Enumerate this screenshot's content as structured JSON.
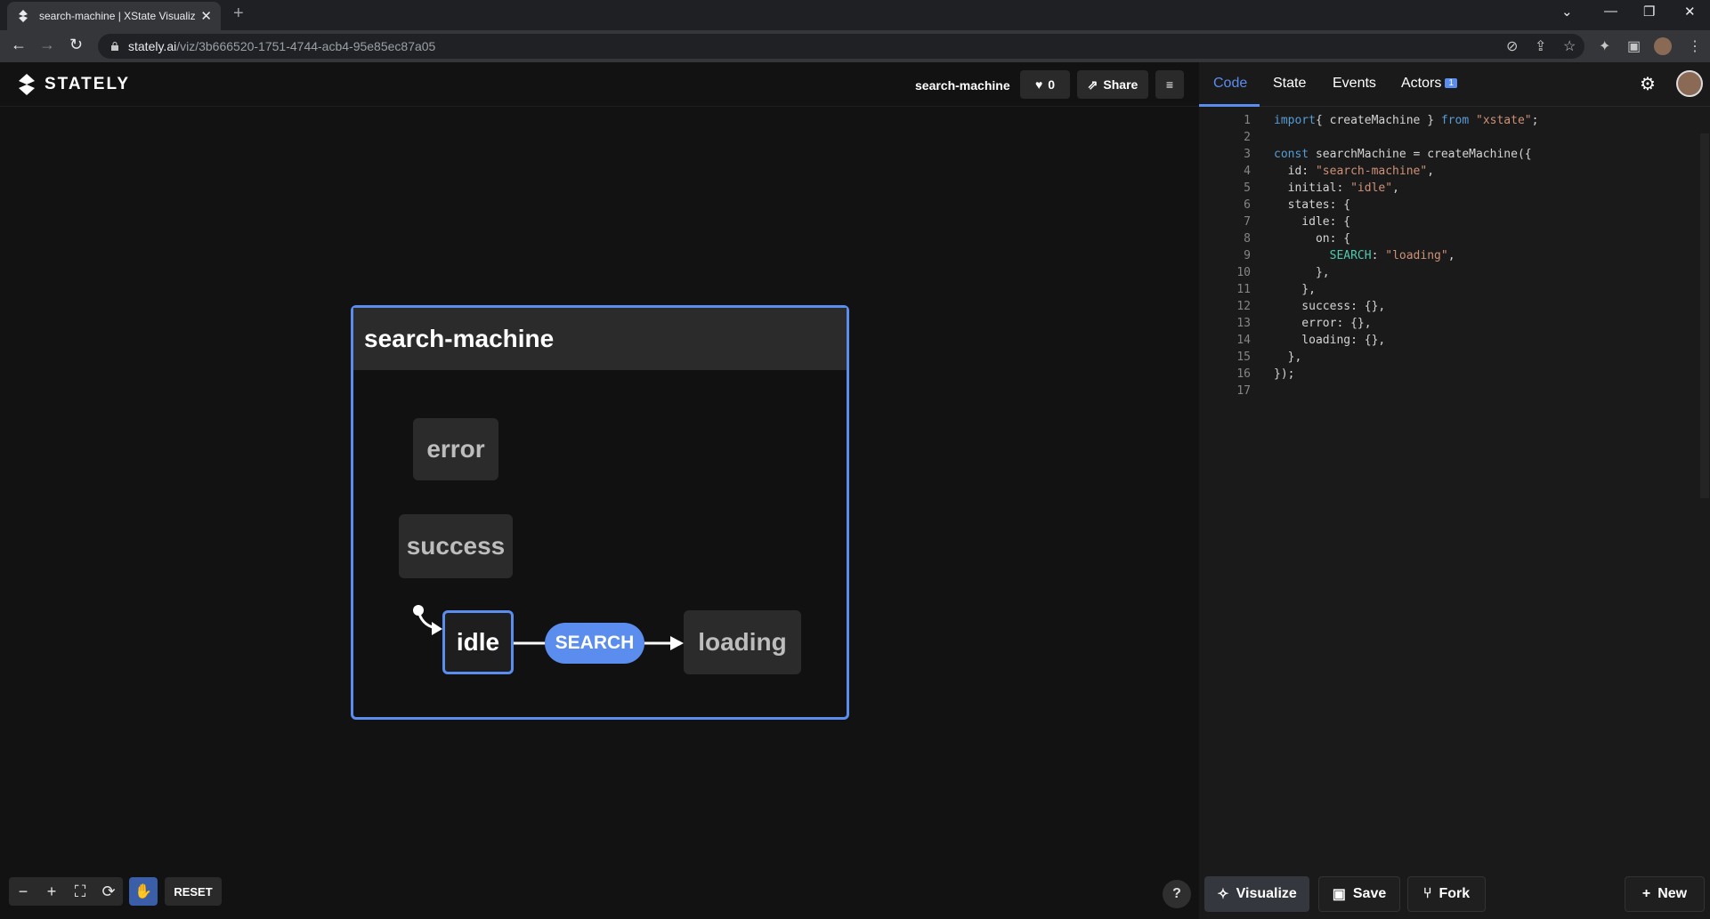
{
  "browser": {
    "tab_title": "search-machine | XState Visualizer",
    "url_host": "stately.ai",
    "url_path": "/viz/3b666520-1751-4744-acb4-95e85ec87a05"
  },
  "header": {
    "logo_text": "STATELY",
    "machine_name": "search-machine",
    "likes": "0",
    "share_label": "Share"
  },
  "panel": {
    "tabs": [
      {
        "label": "Code"
      },
      {
        "label": "State"
      },
      {
        "label": "Events"
      },
      {
        "label": "Actors",
        "badge": "1"
      }
    ],
    "active_tab": "Code"
  },
  "diagram": {
    "machine_title": "search-machine",
    "states": {
      "error": "error",
      "success": "success",
      "idle": "idle",
      "loading": "loading"
    },
    "event_label": "SEARCH",
    "active_state": "idle"
  },
  "code_lines": [
    {
      "n": "1",
      "parts": [
        [
          "kw",
          "import"
        ],
        [
          "",
          "{ createMachine } "
        ],
        [
          "kw",
          "from"
        ],
        [
          "",
          " "
        ],
        [
          "str",
          "\"xstate\""
        ],
        [
          "",
          ";"
        ]
      ]
    },
    {
      "n": "2",
      "parts": []
    },
    {
      "n": "3",
      "parts": [
        [
          "kw",
          "const"
        ],
        [
          "",
          " searchMachine = createMachine({"
        ]
      ]
    },
    {
      "n": "4",
      "parts": [
        [
          "",
          "  id: "
        ],
        [
          "str",
          "\"search-machine\""
        ],
        [
          "",
          ","
        ]
      ]
    },
    {
      "n": "5",
      "parts": [
        [
          "",
          "  initial: "
        ],
        [
          "str",
          "\"idle\""
        ],
        [
          "",
          ","
        ]
      ]
    },
    {
      "n": "6",
      "parts": [
        [
          "",
          "  states: {"
        ]
      ]
    },
    {
      "n": "7",
      "parts": [
        [
          "",
          "    idle: {"
        ]
      ]
    },
    {
      "n": "8",
      "parts": [
        [
          "",
          "      on: {"
        ]
      ]
    },
    {
      "n": "9",
      "parts": [
        [
          "",
          "        "
        ],
        [
          "evk",
          "SEARCH"
        ],
        [
          "",
          ": "
        ],
        [
          "str",
          "\"loading\""
        ],
        [
          "",
          ","
        ]
      ]
    },
    {
      "n": "10",
      "parts": [
        [
          "",
          "      },"
        ]
      ]
    },
    {
      "n": "11",
      "parts": [
        [
          "",
          "    },"
        ]
      ]
    },
    {
      "n": "12",
      "parts": [
        [
          "",
          "    success: {},"
        ]
      ]
    },
    {
      "n": "13",
      "parts": [
        [
          "",
          "    error: {},"
        ]
      ]
    },
    {
      "n": "14",
      "parts": [
        [
          "",
          "    loading: {},"
        ]
      ]
    },
    {
      "n": "15",
      "parts": [
        [
          "",
          "  },"
        ]
      ]
    },
    {
      "n": "16",
      "parts": [
        [
          "",
          "});"
        ]
      ]
    },
    {
      "n": "17",
      "parts": []
    }
  ],
  "canvas_controls": {
    "reset_label": "RESET",
    "help_label": "?"
  },
  "footer": {
    "visualize_label": "Visualize",
    "save_label": "Save",
    "fork_label": "Fork",
    "new_label": "New"
  },
  "colors": {
    "accent": "#5b8def",
    "background": "#121212",
    "panel": "#1a1a1a"
  }
}
